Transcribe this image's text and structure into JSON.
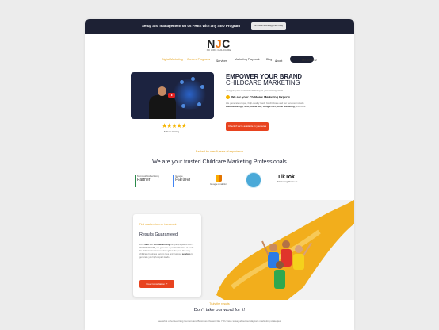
{
  "topbar": {
    "message": "Setup and management on us FREE with any SEO Program",
    "button": "Schedule a Strategy Call Today"
  },
  "logo": {
    "mark_n": "N",
    "mark_j": "J",
    "mark_c": "C",
    "sub": "NO JOKE CHILDCARE"
  },
  "nav": {
    "items": [
      "Digital Marketing",
      "Content Programs",
      "Services",
      "Marketing Playbook",
      "Blog",
      "About"
    ],
    "call": "786-600-8012"
  },
  "hero": {
    "rating": "5 Stars Rating",
    "title_line1": "EMPOWER YOUR BRAND",
    "title_line2": "CHILDCARE MARKETING",
    "small": "Struggling with childcare marketing for your existing center?",
    "expert": "We are your Childcare Marketing Experts",
    "para_intro": "We generate unique, high-quality leads for childcare and our services include",
    "para_links": "Website Design, SEO, Social ads, Google Ads, Email Marketing,",
    "para_end": "and more.",
    "cta": "Check if we're available in your area"
  },
  "trust": {
    "backed": "Backed by over 9 years of experience",
    "title": "We are your trusted Childcare Marketing Professionals",
    "partners": [
      {
        "small": "Microsoft   Advertising",
        "big": "Partner"
      },
      {
        "small": "Google",
        "big": "Partner"
      },
      {
        "small": "Google Analytics"
      },
      {
        "small": ""
      },
      {
        "big": "TikTok",
        "small": "Marketing Partners"
      }
    ]
  },
  "results": {
    "kicker": "Find results return on investment",
    "headline": "Results Guaranteed",
    "para_1": "With",
    "para_seo": "SEO",
    "para_2": "and",
    "para_ppc": "PPC advertising",
    "para_3": "campaigns paired with a",
    "para_site": "custom website,",
    "para_4": "we generate a predictable flow of leads for childcare businesses throughout the year. Not only childcare business owners love and trust our",
    "para_services": "services",
    "para_5": "to generate you high-impact leads.",
    "button": "Free Consultation"
  },
  "bottom": {
    "kicker": "Truly the results",
    "title": "Don't take our word for it!",
    "para": "See what other Learning Centers and Business Owners like YOU have to say about our daycare marketing strategies."
  },
  "colors": {
    "navy": "#1d2134",
    "orange": "#e8431f",
    "gold": "#e4a21c",
    "yellow": "#f2ae1c"
  }
}
